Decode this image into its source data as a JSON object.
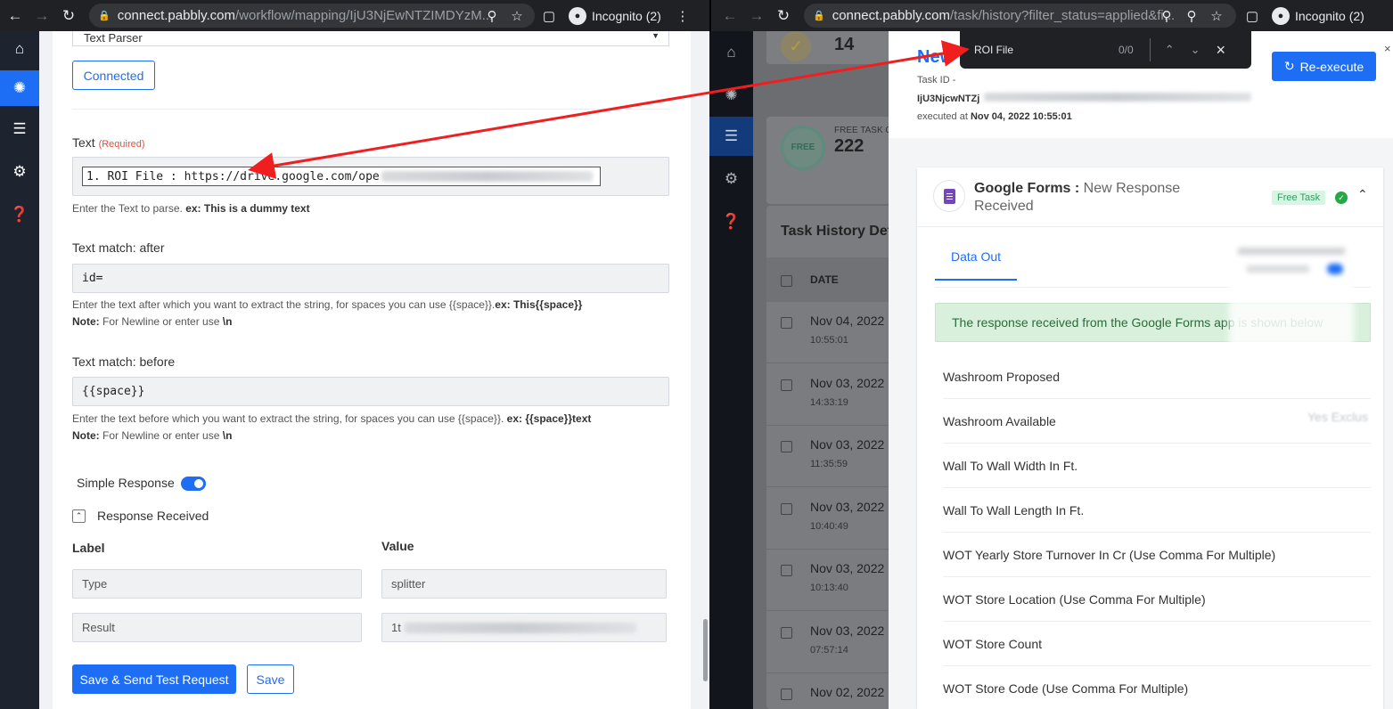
{
  "left_browser": {
    "url_host": "connect.pabbly.com",
    "url_path": "/workflow/mapping/IjU3NjEwNTZIMDYzM...",
    "incognito_label": "Incognito (2)"
  },
  "right_browser": {
    "url_host": "connect.pabbly.com",
    "url_path": "/task/history?filter_status=applied&fi...",
    "incognito_label": "Incognito (2)"
  },
  "find_bar": {
    "query": "ROI File",
    "count": "0/0"
  },
  "mapping": {
    "action_select": "Text Parser",
    "connected_button": "Connected",
    "text_label": "Text",
    "required_tag": "(Required)",
    "text_value": "1. ROI File : https://drive.google.com/ope",
    "text_hint_prefix": "Enter the Text to parse.",
    "text_hint_bold": "ex: This is a dummy text",
    "after_label": "Text match: after",
    "after_value": "id=",
    "after_hint_prefix": "Enter the text after which you want to extract the string, for spaces you can use {{space}}.",
    "after_hint_bold": "ex: This{{space}}",
    "after_note_label": "Note:",
    "after_note_text": "For Newline or enter use",
    "after_note_code": "\\n",
    "before_label": "Text match: before",
    "before_value": "{{space}}",
    "before_hint_prefix": "Enter the text before which you want to extract the string, for spaces you can use {{space}}.",
    "before_hint_bold": "ex: {{space}}text",
    "before_note_label": "Note:",
    "before_note_text": "For Newline or enter use",
    "before_note_code": "\\n",
    "simple_response_label": "Simple Response",
    "simple_response_on": true,
    "response_received_label": "Response Received",
    "col_label": "Label",
    "col_value": "Value",
    "rows": [
      {
        "label": "Type",
        "value": "splitter"
      },
      {
        "label": "Result",
        "value": "1t"
      }
    ],
    "save_send_button": "Save & Send Test Request",
    "save_button": "Save"
  },
  "task_history": {
    "stat1_value": "14",
    "stat2_label": "FREE TASK C",
    "stat2_value": "222",
    "free_badge": "FREE",
    "table_title": "Task History Det",
    "date_header": "DATE",
    "dates": [
      {
        "date": "Nov 04, 2022",
        "time": "10:55:01"
      },
      {
        "date": "Nov 03, 2022",
        "time": "14:33:19"
      },
      {
        "date": "Nov 03, 2022",
        "time": "11:35:59"
      },
      {
        "date": "Nov 03, 2022",
        "time": "10:40:49"
      },
      {
        "date": "Nov 03, 2022",
        "time": "10:13:40"
      },
      {
        "date": "Nov 03, 2022",
        "time": "07:57:14"
      },
      {
        "date": "Nov 02, 2022",
        "time": ""
      }
    ]
  },
  "task_detail": {
    "title_partial": "New",
    "task_id_label": "Task ID -",
    "task_id_value": "IjU3NjcwNTZj",
    "executed_label": "executed at",
    "executed_at": "Nov 04, 2022 10:55:01",
    "reexecute_button": "Re-execute",
    "app_name": "Google Forms",
    "separator": " : ",
    "event_name": "New Response Received",
    "free_task_badge": "Free Task",
    "tab_data_out": "Data Out",
    "success_message": "The response received from the Google Forms app is shown below",
    "partial_value": "Yes Exclus",
    "fields": [
      "Washroom Proposed",
      "Washroom Available",
      "Wall To Wall Width In Ft.",
      "Wall To Wall Length In Ft.",
      "WOT Yearly Store Turnover In Cr (Use Comma For Multiple)",
      "WOT Store Location (Use Comma For Multiple)",
      "WOT Store Count",
      "WOT Store Code (Use Comma For Multiple)"
    ]
  },
  "colors": {
    "primary": "#1d6ef5",
    "annotation_arrow": "#f01e1e",
    "success_bg": "#d9f0dd",
    "free_badge_bg": "#d6f5e3"
  }
}
